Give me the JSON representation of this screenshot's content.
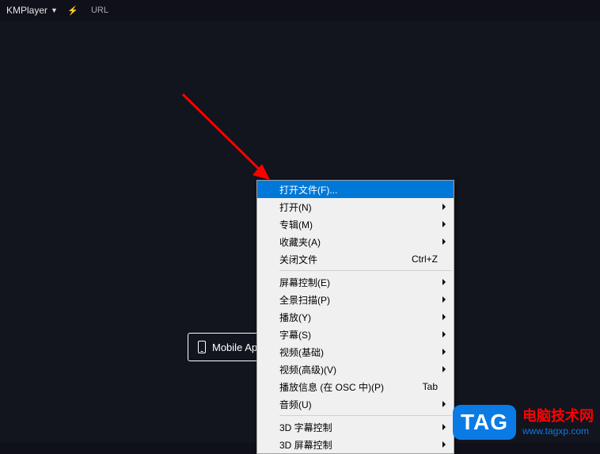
{
  "titlebar": {
    "app_name": "KMPlayer",
    "url_label": "URL"
  },
  "mobile_button": {
    "label_visible": "Mobile Ap"
  },
  "menu": {
    "open_file": "打开文件(F)...",
    "open": "打开(N)",
    "album": "专辑(M)",
    "favorites": "收藏夹(A)",
    "close_file": "关闭文件",
    "close_file_shortcut": "Ctrl+Z",
    "screen_control": "屏幕控制(E)",
    "pano_scan": "全景扫描(P)",
    "play": "播放(Y)",
    "subtitle": "字幕(S)",
    "video_basic": "视频(基础)",
    "video_adv": "视频(高级)(V)",
    "play_info": "播放信息 (在 OSC 中)(P)",
    "play_info_shortcut": "Tab",
    "audio": "音频(U)",
    "sub_3d": "3D 字幕控制",
    "screen_3d": "3D 屏幕控制"
  },
  "watermark": {
    "tag": "TAG",
    "cn": "电脑技术网",
    "url": "www.tagxp.com"
  }
}
